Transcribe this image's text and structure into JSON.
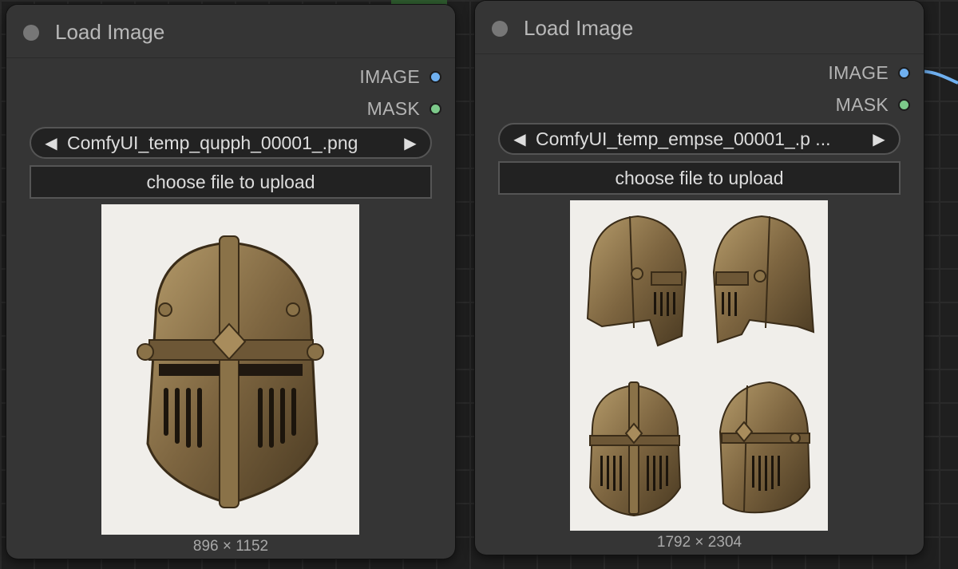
{
  "nodes": [
    {
      "title": "Load Image",
      "outputs": [
        {
          "label": "IMAGE",
          "color": "#6fb0f0"
        },
        {
          "label": "MASK",
          "color": "#7cc98a"
        }
      ],
      "image_selector": {
        "value": "ComfyUI_temp_qupph_00001_.png",
        "prev_icon": "triangle-left-icon",
        "next_icon": "triangle-right-icon"
      },
      "upload_label": "choose file to upload",
      "preview": {
        "content": "single helmet front view",
        "dimensions": "896 × 1152"
      }
    },
    {
      "title": "Load Image",
      "outputs": [
        {
          "label": "IMAGE",
          "color": "#6fb0f0"
        },
        {
          "label": "MASK",
          "color": "#7cc98a"
        }
      ],
      "image_selector": {
        "value": "ComfyUI_temp_empse_00001_.p ...",
        "prev_icon": "triangle-left-icon",
        "next_icon": "triangle-right-icon"
      },
      "upload_label": "choose file to upload",
      "preview": {
        "content": "four helmet views grid",
        "dimensions": "1792 × 2304"
      }
    }
  ],
  "colors": {
    "canvas": "#1f1f1f",
    "node_bg": "#353535",
    "widget_bg": "#222222",
    "image_link": "#6fb0f0",
    "mask_link": "#7cc98a"
  }
}
